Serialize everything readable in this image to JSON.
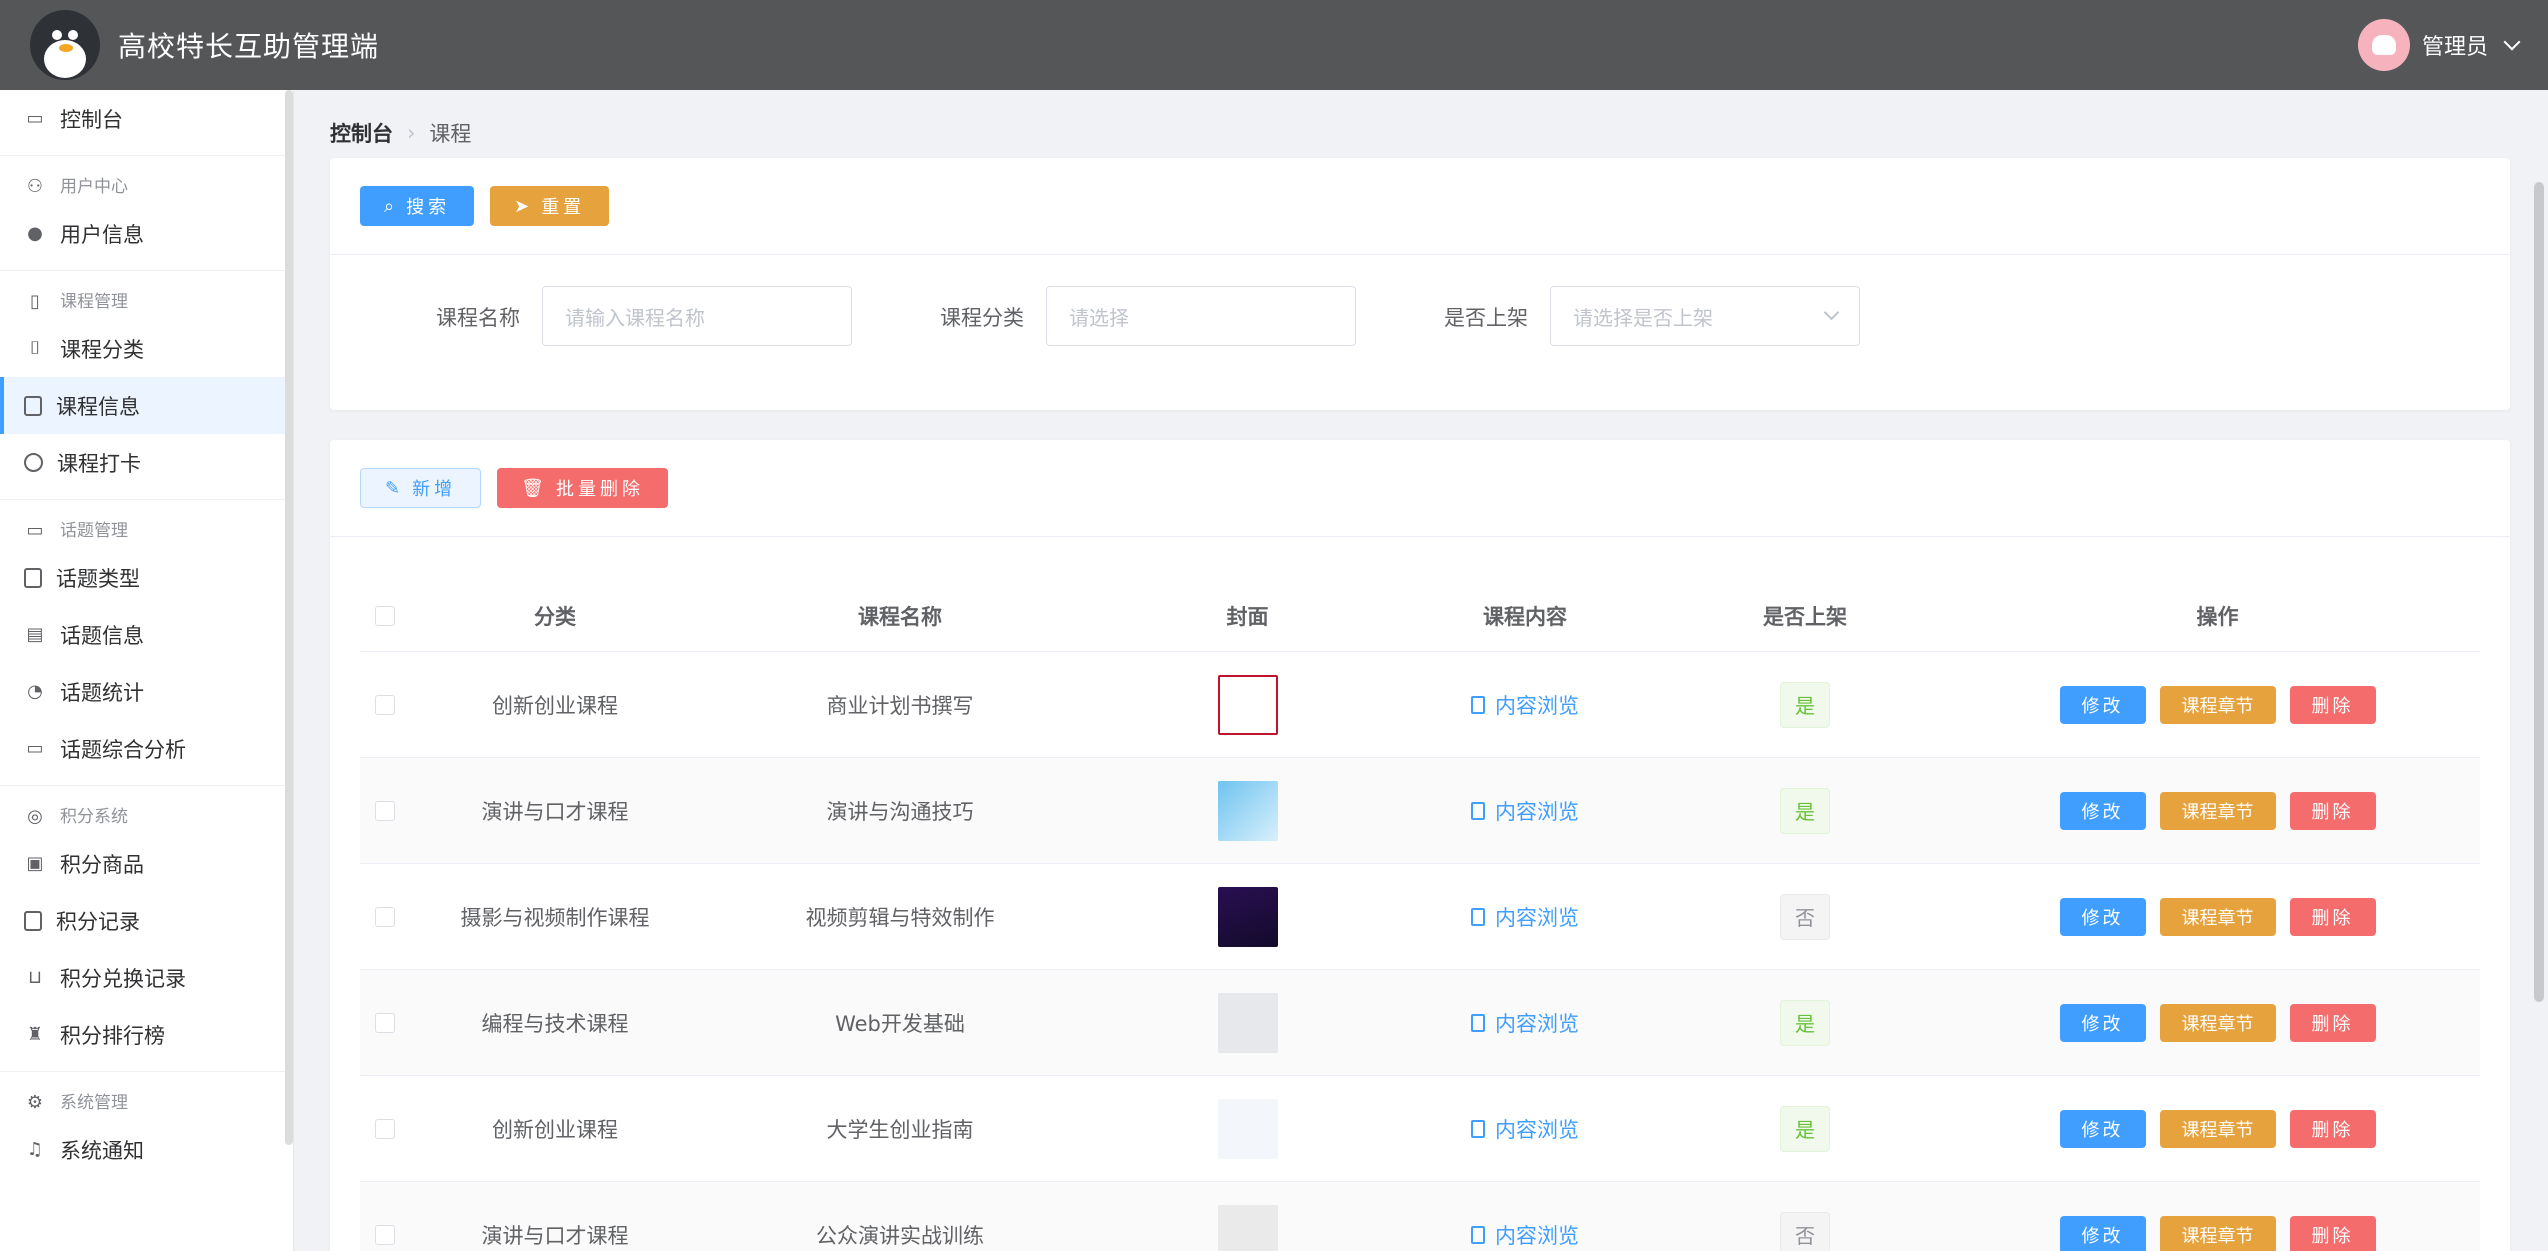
{
  "header": {
    "title": "高校特长互助管理端",
    "user": "管理员"
  },
  "sidebar": {
    "top_item": "控制台",
    "groups": [
      {
        "label": "用户中心",
        "items": [
          "用户信息"
        ]
      },
      {
        "label": "课程管理",
        "items": [
          "课程分类",
          "课程信息",
          "课程打卡"
        ]
      },
      {
        "label": "话题管理",
        "items": [
          "话题类型",
          "话题信息",
          "话题统计",
          "话题综合分析"
        ]
      },
      {
        "label": "积分系统",
        "items": [
          "积分商品",
          "积分记录",
          "积分兑换记录",
          "积分排行榜"
        ]
      },
      {
        "label": "系统管理",
        "items": [
          "系统通知"
        ]
      }
    ]
  },
  "breadcrumb": {
    "root": "控制台",
    "current": "课程"
  },
  "search": {
    "search_btn": "搜索",
    "reset_btn": "重置",
    "name_label": "课程名称",
    "name_placeholder": "请输入课程名称",
    "cat_label": "课程分类",
    "cat_placeholder": "请选择",
    "shelf_label": "是否上架",
    "shelf_placeholder": "请选择是否上架"
  },
  "toolbar": {
    "add": "新增",
    "batch_delete": "批量删除"
  },
  "table": {
    "headers": [
      "分类",
      "课程名称",
      "封面",
      "课程内容",
      "是否上架",
      "操作"
    ],
    "rows": [
      {
        "category": "创新创业课程",
        "name": "商业计划书撰写",
        "content": "内容浏览",
        "status": "是",
        "edit": "修改",
        "chapter": "课程章节",
        "delete": "删除"
      },
      {
        "category": "演讲与口才课程",
        "name": "演讲与沟通技巧",
        "content": "内容浏览",
        "status": "是",
        "edit": "修改",
        "chapter": "课程章节",
        "delete": "删除"
      },
      {
        "category": "摄影与视频制作课程",
        "name": "视频剪辑与特效制作",
        "content": "内容浏览",
        "status": "否",
        "edit": "修改",
        "chapter": "课程章节",
        "delete": "删除"
      },
      {
        "category": "编程与技术课程",
        "name": "Web开发基础",
        "content": "内容浏览",
        "status": "是",
        "edit": "修改",
        "chapter": "课程章节",
        "delete": "删除"
      },
      {
        "category": "创新创业课程",
        "name": "大学生创业指南",
        "content": "内容浏览",
        "status": "是",
        "edit": "修改",
        "chapter": "课程章节",
        "delete": "删除"
      },
      {
        "category": "演讲与口才课程",
        "name": "公众演讲实战训练",
        "content": "内容浏览",
        "status": "否",
        "edit": "修改",
        "chapter": "课程章节",
        "delete": "删除"
      }
    ]
  },
  "colors": {
    "primary": "#409eff",
    "warning": "#e6a23c",
    "danger": "#f56c6c",
    "header": "#545658"
  }
}
